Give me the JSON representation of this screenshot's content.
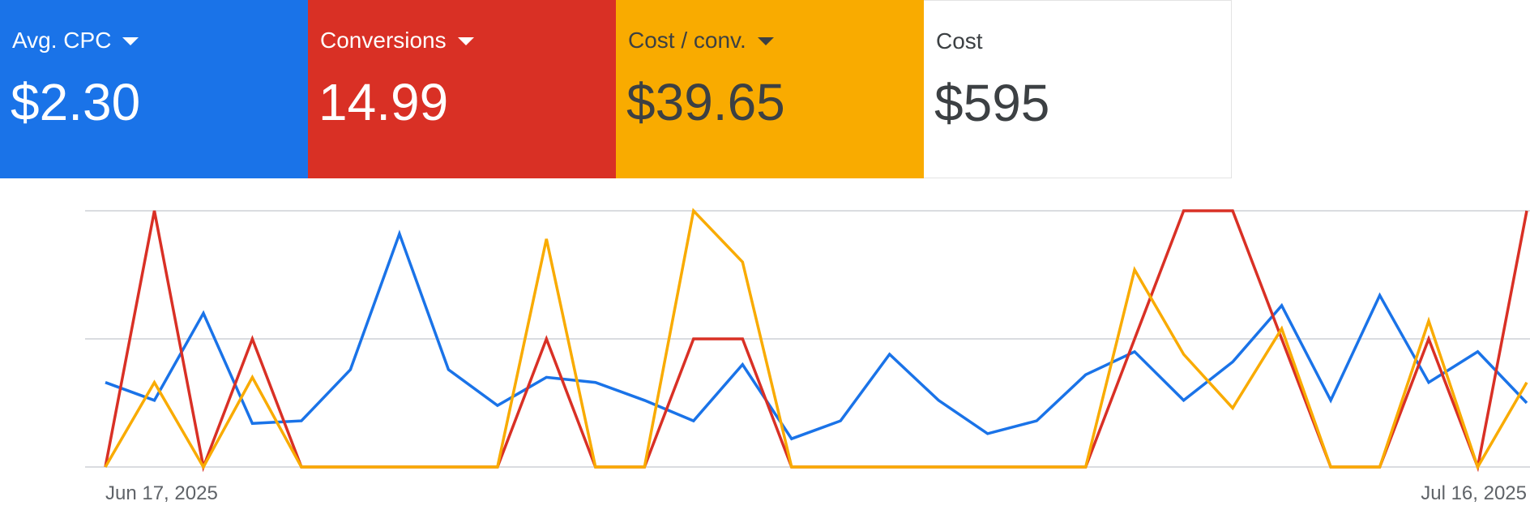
{
  "scorecards": [
    {
      "label": "Avg. CPC",
      "value": "$2.30",
      "bg": "#1A73E8",
      "fg": "#FFFFFF",
      "dropdown": true
    },
    {
      "label": "Conversions",
      "value": "14.99",
      "bg": "#D93025",
      "fg": "#FFFFFF",
      "dropdown": true
    },
    {
      "label": "Cost / conv.",
      "value": "$39.65",
      "bg": "#F9AB00",
      "fg": "#3C4043",
      "dropdown": true
    },
    {
      "label": "Cost",
      "value": "$595",
      "bg": "#FFFFFF",
      "fg": "#3C4043",
      "dropdown": false
    }
  ],
  "chart_data": {
    "type": "line",
    "x_labels": [
      "Jun 17, 2025",
      "Jul 16, 2025"
    ],
    "x_start": "2025-06-17",
    "x_end": "2025-07-16",
    "grid": true,
    "ylim": [
      0,
      1
    ],
    "series": [
      {
        "color": "#1A73E8",
        "values": [
          0.33,
          0.26,
          0.6,
          0.17,
          0.18,
          0.38,
          0.91,
          0.38,
          0.24,
          0.35,
          0.33,
          0.26,
          0.18,
          0.4,
          0.11,
          0.18,
          0.44,
          0.26,
          0.13,
          0.18,
          0.36,
          0.45,
          0.26,
          0.41,
          0.63,
          0.26,
          0.67,
          0.33,
          0.45,
          0.25
        ]
      },
      {
        "color": "#D93025",
        "values": [
          0,
          1,
          0,
          0.5,
          0,
          0,
          0,
          0,
          0,
          0.5,
          0,
          0,
          0.5,
          0.5,
          0,
          0,
          0,
          0,
          0,
          0,
          0,
          0.5,
          1,
          1,
          0.5,
          0,
          0,
          0.5,
          0,
          1
        ]
      },
      {
        "color": "#F9AB00",
        "values": [
          0,
          0.33,
          0,
          0.35,
          0,
          0,
          0,
          0,
          0,
          0.89,
          0,
          0,
          1,
          0.8,
          0,
          0,
          0,
          0,
          0,
          0,
          0,
          0.77,
          0.44,
          0.23,
          0.54,
          0,
          0,
          0.57,
          0,
          0.33
        ]
      }
    ]
  }
}
